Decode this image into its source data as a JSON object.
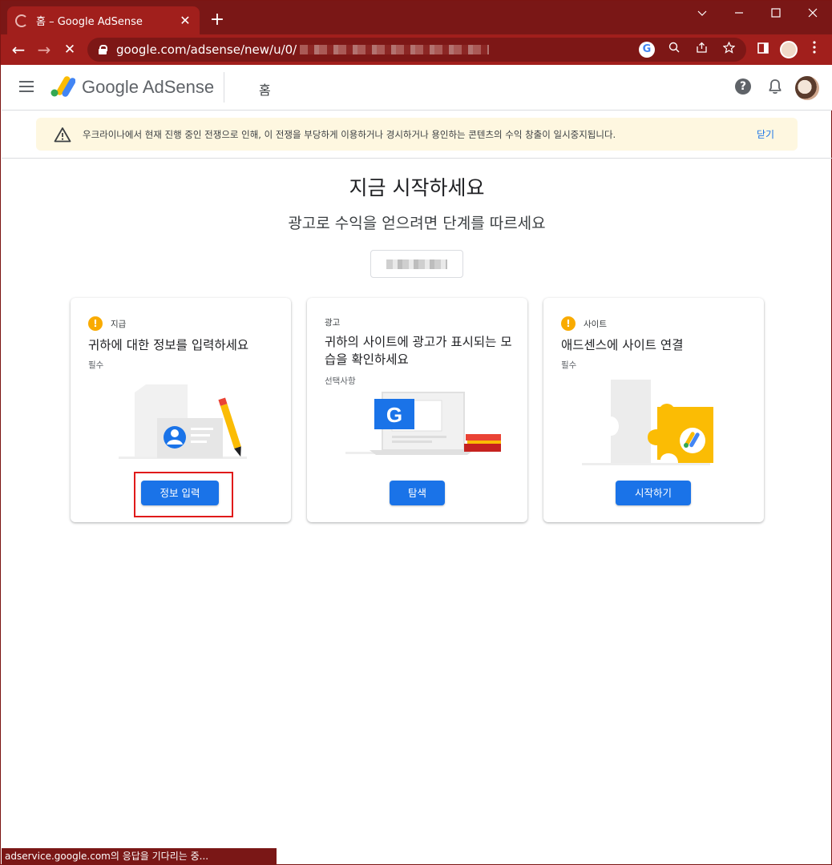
{
  "browser": {
    "tab_title": "홈 – Google AdSense",
    "tab_close": "✕",
    "new_tab": "+",
    "url_visible": "google.com/adsense/new/u/0/",
    "window_controls": {
      "minimize": "—",
      "maximize": "☐",
      "close": "✕"
    },
    "nav": {
      "back": "←",
      "forward": "→",
      "stop": "✕"
    }
  },
  "app": {
    "brand": "Google AdSense",
    "page_label": "홈",
    "help_label": "?"
  },
  "banner": {
    "message": "우크라이나에서 현재 진행 중인 전쟁으로 인해, 이 전쟁을 부당하게 이용하거나 경시하거나 용인하는 콘텐츠의 수익 창출이 일시중지됩니다.",
    "close_label": "닫기"
  },
  "hero": {
    "title": "지금 시작하세요",
    "subtitle": "광고로 수익을 얻으려면 단계를 따르세요"
  },
  "cards": [
    {
      "tag": "지급",
      "heading": "귀하에 대한 정보를 입력하세요",
      "requirement": "필수",
      "button": "정보 입력",
      "alert": "!"
    },
    {
      "tag": "광고",
      "heading": "귀하의 사이트에 광고가 표시되는 모습을 확인하세요",
      "requirement": "선택사항",
      "button": "탐색"
    },
    {
      "tag": "사이트",
      "heading": "애드센스에 사이트 연결",
      "requirement": "필수",
      "button": "시작하기",
      "alert": "!"
    }
  ],
  "status_bar": "adservice.google.com의 응답을 기다리는 중...",
  "colors": {
    "accent": "#1a73e8",
    "chrome": "#a11f1c",
    "warning": "#f9ab00",
    "highlight": "#e01a1a"
  },
  "icons": [
    "hamburger-icon",
    "adsense-logo-icon",
    "help-icon",
    "bell-icon",
    "warning-icon",
    "alert-icon",
    "lock-icon"
  ]
}
